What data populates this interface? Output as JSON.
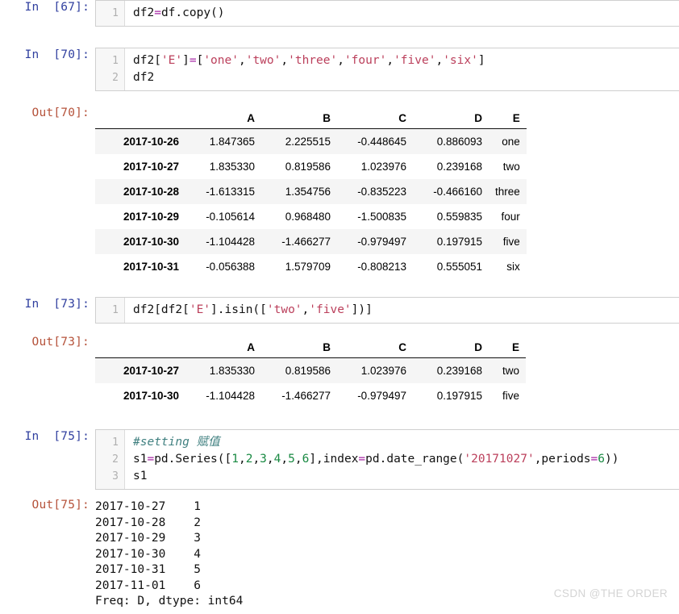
{
  "watermark": "CSDN @THE ORDER",
  "cells": [
    {
      "prompt_in": "In  [67]:",
      "lines": [
        "1"
      ],
      "code_plain": "df2=df.copy()"
    },
    {
      "prompt_in": "In  [70]:",
      "lines": [
        "1",
        "2"
      ],
      "code_plain": "df2['E']=['one','two','three','four','five','six']\ndf2"
    },
    {
      "prompt_out": "Out[70]:"
    },
    {
      "prompt_in": "In  [73]:",
      "lines": [
        "1"
      ],
      "code_plain": "df2[df2['E'].isin(['two','five'])]"
    },
    {
      "prompt_out": "Out[73]:"
    },
    {
      "prompt_in": "In  [75]:",
      "lines": [
        "1",
        "2",
        "3"
      ],
      "code_plain": "#setting 赋值\ns1=pd.Series([1,2,3,4,5,6],index=pd.date_range('20171027',periods=6))\ns1"
    },
    {
      "prompt_out": "Out[75]:"
    }
  ],
  "code_67": {
    "l1_a": "df2",
    "l1_eq": "=",
    "l1_b": "df.copy()"
  },
  "code_70": {
    "l1_a": "df2[",
    "l1_key": "'E'",
    "l1_b": "]",
    "l1_eq": "=",
    "l1_c": "[",
    "l1_s1": "'one'",
    "l1_c1": ",",
    "l1_s2": "'two'",
    "l1_c2": ",",
    "l1_s3": "'three'",
    "l1_c3": ",",
    "l1_s4": "'four'",
    "l1_c4": ",",
    "l1_s5": "'five'",
    "l1_c5": ",",
    "l1_s6": "'six'",
    "l1_d": "]",
    "l2": "df2"
  },
  "code_73": {
    "a": "df2[df2[",
    "key": "'E'",
    "b": "].isin([",
    "s1": "'two'",
    "c1": ",",
    "s2": "'five'",
    "d": "])]"
  },
  "code_75": {
    "comment": "#setting 赋值",
    "l2_a": "s1",
    "l2_eq": "=",
    "l2_b": "pd.Series([",
    "l2_n1": "1",
    "l2_c1": ",",
    "l2_n2": "2",
    "l2_c2": ",",
    "l2_n3": "3",
    "l2_c3": ",",
    "l2_n4": "4",
    "l2_c4": ",",
    "l2_n5": "5",
    "l2_c5": ",",
    "l2_n6": "6",
    "l2_c": "],index",
    "l2_eq2": "=",
    "l2_d": "pd.date_range(",
    "l2_date": "'20171027'",
    "l2_e": ",periods",
    "l2_eq3": "=",
    "l2_n7": "6",
    "l2_f": "))",
    "l3": "s1"
  },
  "table_70": {
    "columns": [
      "A",
      "B",
      "C",
      "D",
      "E"
    ],
    "index_name": "",
    "rows": [
      {
        "index": "2017-10-26",
        "A": "1.847365",
        "B": "2.225515",
        "C": "-0.448645",
        "D": "0.886093",
        "E": "one"
      },
      {
        "index": "2017-10-27",
        "A": "1.835330",
        "B": "0.819586",
        "C": "1.023976",
        "D": "0.239168",
        "E": "two"
      },
      {
        "index": "2017-10-28",
        "A": "-1.613315",
        "B": "1.354756",
        "C": "-0.835223",
        "D": "-0.466160",
        "E": "three"
      },
      {
        "index": "2017-10-29",
        "A": "-0.105614",
        "B": "0.968480",
        "C": "-1.500835",
        "D": "0.559835",
        "E": "four"
      },
      {
        "index": "2017-10-30",
        "A": "-1.104428",
        "B": "-1.466277",
        "C": "-0.979497",
        "D": "0.197915",
        "E": "five"
      },
      {
        "index": "2017-10-31",
        "A": "-0.056388",
        "B": "1.579709",
        "C": "-0.808213",
        "D": "0.555051",
        "E": "six"
      }
    ]
  },
  "table_73": {
    "columns": [
      "A",
      "B",
      "C",
      "D",
      "E"
    ],
    "index_name": "",
    "rows": [
      {
        "index": "2017-10-27",
        "A": "1.835330",
        "B": "0.819586",
        "C": "1.023976",
        "D": "0.239168",
        "E": "two"
      },
      {
        "index": "2017-10-30",
        "A": "-1.104428",
        "B": "-1.466277",
        "C": "-0.979497",
        "D": "0.197915",
        "E": "five"
      }
    ]
  },
  "series_75": {
    "entries": [
      {
        "date": "2017-10-27",
        "value": "1"
      },
      {
        "date": "2017-10-28",
        "value": "2"
      },
      {
        "date": "2017-10-29",
        "value": "3"
      },
      {
        "date": "2017-10-30",
        "value": "4"
      },
      {
        "date": "2017-10-31",
        "value": "5"
      },
      {
        "date": "2017-11-01",
        "value": "6"
      }
    ],
    "footer": "Freq: D, dtype: int64",
    "text": "2017-10-27    1\n2017-10-28    2\n2017-10-29    3\n2017-10-30    4\n2017-10-31    5\n2017-11-01    6\nFreq: D, dtype: int64"
  }
}
